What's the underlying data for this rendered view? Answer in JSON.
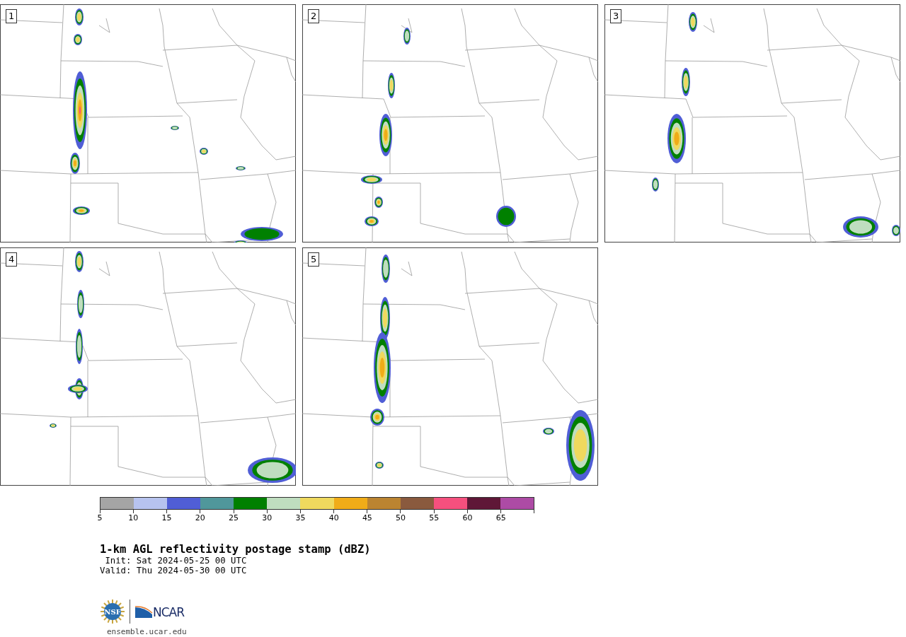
{
  "panels": [
    {
      "label": "1"
    },
    {
      "label": "2"
    },
    {
      "label": "3"
    },
    {
      "label": "4"
    },
    {
      "label": "5"
    }
  ],
  "colorbar": {
    "bins": [
      {
        "color": "#a5a5a5"
      },
      {
        "color": "#b7c3ef"
      },
      {
        "color": "#505ed6"
      },
      {
        "color": "#50979b"
      },
      {
        "color": "#008000"
      },
      {
        "color": "#bfddbf"
      },
      {
        "color": "#efd95e"
      },
      {
        "color": "#f0ac18"
      },
      {
        "color": "#bb8431"
      },
      {
        "color": "#8a5a3e"
      },
      {
        "color": "#f5507e"
      },
      {
        "color": "#5f1737"
      },
      {
        "color": "#ad4ba5"
      }
    ],
    "ticks": [
      "5",
      "10",
      "15",
      "20",
      "25",
      "30",
      "35",
      "40",
      "45",
      "50",
      "55",
      "60",
      "65"
    ]
  },
  "title": "1-km AGL reflectivity postage stamp (dBZ)",
  "init": "Init: Sat 2024-05-25 00 UTC",
  "valid": "Valid: Thu 2024-05-30 00 UTC",
  "logo": {
    "nsf": "NSF",
    "ncar": "NCAR"
  },
  "url": "ensemble.ucar.edu"
}
